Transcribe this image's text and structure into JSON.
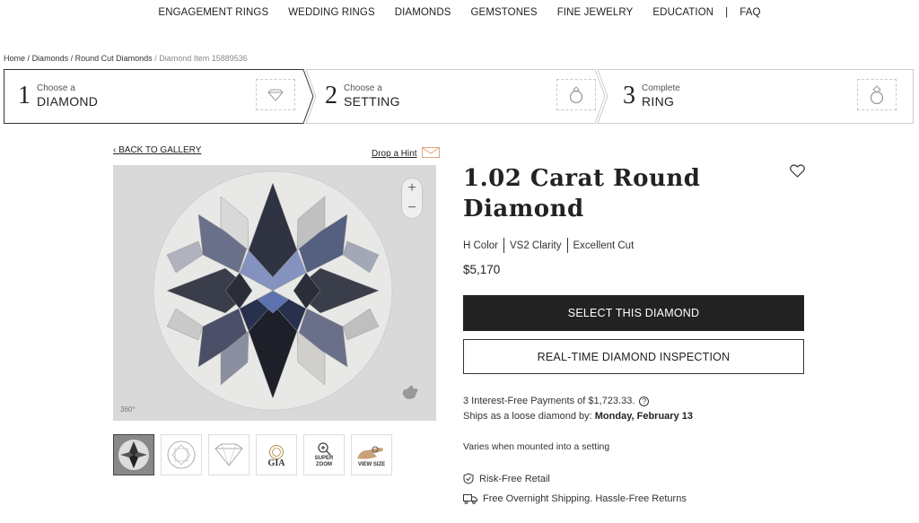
{
  "nav": {
    "items": [
      "ENGAGEMENT RINGS",
      "WEDDING RINGS",
      "DIAMONDS",
      "GEMSTONES",
      "FINE JEWELRY",
      "EDUCATION"
    ],
    "separator": "|",
    "faq": "FAQ"
  },
  "breadcrumb": {
    "home": "Home",
    "diamonds": "Diamonds",
    "round": "Round Cut Diamonds",
    "item": "Diamond Item 15889536",
    "sep": "/"
  },
  "steps": [
    {
      "num": "1",
      "small": "Choose a",
      "big": "DIAMOND",
      "icon": "diamond-outline-icon"
    },
    {
      "num": "2",
      "small": "Choose a",
      "big": "SETTING",
      "icon": "ring-setting-icon"
    },
    {
      "num": "3",
      "small": "Complete",
      "big": "RING",
      "icon": "complete-ring-icon"
    }
  ],
  "back_label": "BACK TO GALLERY",
  "hint_label": "Drop a Hint",
  "viewer": {
    "zoom_in": "+",
    "zoom_out": "−",
    "badge_360": "360°"
  },
  "thumbs": [
    {
      "name": "thumb-diamond-photo",
      "label": ""
    },
    {
      "name": "thumb-top-diagram",
      "label": ""
    },
    {
      "name": "thumb-side-diagram",
      "label": ""
    },
    {
      "name": "thumb-gia-certificate",
      "label": "GIA"
    },
    {
      "name": "thumb-super-zoom",
      "label": "SUPER ZOOM"
    },
    {
      "name": "thumb-view-size",
      "label": "VIEW SIZE"
    }
  ],
  "product": {
    "title_line1": "1.02 Carat Round",
    "title_line2": "Diamond",
    "color": "H Color",
    "clarity": "VS2 Clarity",
    "cut": "Excellent Cut",
    "price": "$5,170"
  },
  "buttons": {
    "select": "SELECT THIS DIAMOND",
    "inspection": "REAL-TIME DIAMOND INSPECTION"
  },
  "payments": {
    "line1": "3 Interest-Free Payments of $1,723.33.",
    "line2_prefix": "Ships as a loose diamond by:",
    "ship_date": "Monday, February 13"
  },
  "varies": "Varies when mounted into a setting",
  "perks": {
    "risk_free": "Risk-Free Retail",
    "shipping": "Free Overnight Shipping. Hassle-Free Returns"
  },
  "colors": {
    "dark": "#222222",
    "hint_accent": "#e2a57a",
    "viewer_bg": "#d9d9d9"
  }
}
